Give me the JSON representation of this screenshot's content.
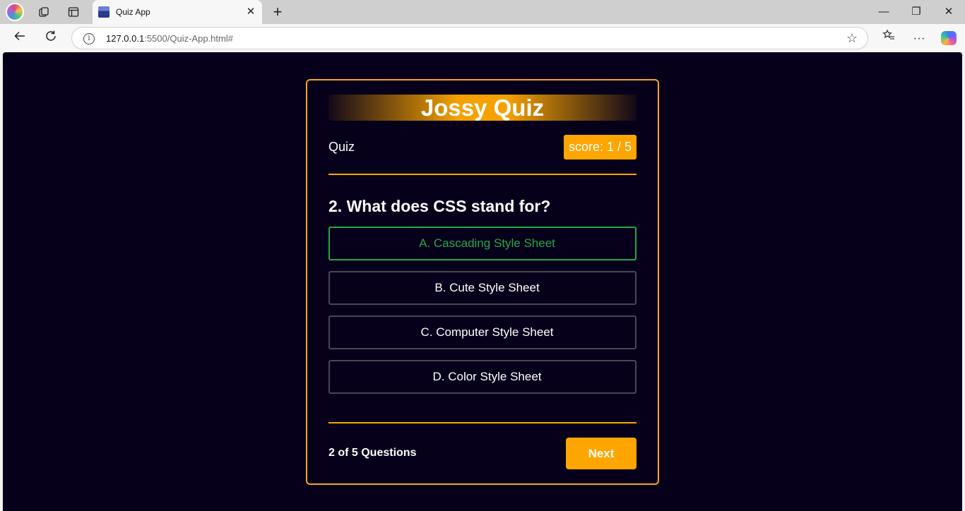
{
  "browser": {
    "tab_title": "Quiz App",
    "tab_close": "✕",
    "new_tab": "+",
    "url_host": "127.0.0.1",
    "url_rest": ":5500/Quiz-App.html#",
    "window": {
      "minimize": "—",
      "restore": "❐",
      "close": "✕"
    }
  },
  "quiz": {
    "banner_title": "Jossy Quiz",
    "label": "Quiz",
    "score": "score: 1 / 5",
    "question": "2. What does CSS stand for?",
    "options": [
      {
        "text": "A. Cascading Style Sheet",
        "state": "correct"
      },
      {
        "text": "B. Cute Style Sheet",
        "state": "default"
      },
      {
        "text": "C. Computer Style Sheet",
        "state": "default"
      },
      {
        "text": "D. Color Style Sheet",
        "state": "default"
      }
    ],
    "counter": "2 of 5 Questions",
    "next_label": "Next"
  },
  "colors": {
    "accent": "#ffa500",
    "background": "#06001a",
    "correct": "#25a84a"
  }
}
